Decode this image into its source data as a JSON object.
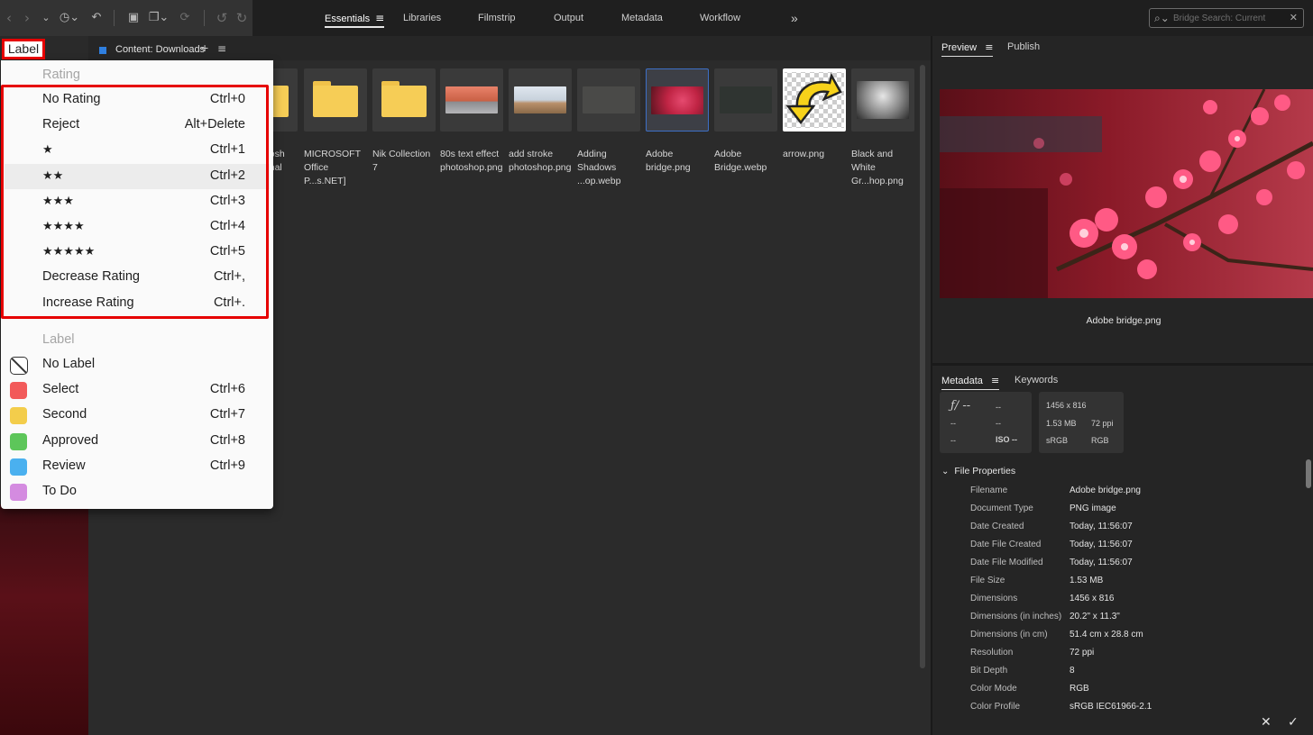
{
  "toolbar": {
    "workspaces": [
      {
        "label": "Essentials",
        "active": true
      },
      {
        "label": "Libraries"
      },
      {
        "label": "Filmstrip"
      },
      {
        "label": "Output"
      },
      {
        "label": "Metadata"
      },
      {
        "label": "Workflow"
      }
    ],
    "more_glyph": "»",
    "search_placeholder": "Bridge Search: Current"
  },
  "label_tab": "Label",
  "content": {
    "tab_title": "Content: Downloads",
    "items": [
      {
        "label": "otosh Final",
        "kind": "folder"
      },
      {
        "label": "MICROSOFT Office P...s.NET]",
        "kind": "folder"
      },
      {
        "label": "Nik Collection 7",
        "kind": "folder"
      },
      {
        "label": "80s text effect photoshop.png",
        "kind": "image"
      },
      {
        "label": "add stroke photoshop.png",
        "kind": "image"
      },
      {
        "label": "Adding Shadows ...op.webp",
        "kind": "image"
      },
      {
        "label": "Adobe bridge.png",
        "kind": "image",
        "selected": true
      },
      {
        "label": "Adobe Bridge.webp",
        "kind": "image"
      },
      {
        "label": "arrow.png",
        "kind": "image"
      },
      {
        "label": "Black and White Gr...hop.png",
        "kind": "image"
      }
    ]
  },
  "menu": {
    "rating_header": "Rating",
    "rating_items": [
      {
        "label": "No Rating",
        "shortcut": "Ctrl+0"
      },
      {
        "label": "Reject",
        "shortcut": "Alt+Delete"
      },
      {
        "label": "★",
        "shortcut": "Ctrl+1"
      },
      {
        "label": "★★",
        "shortcut": "Ctrl+2",
        "hover": true
      },
      {
        "label": "★★★",
        "shortcut": "Ctrl+3"
      },
      {
        "label": "★★★★",
        "shortcut": "Ctrl+4"
      },
      {
        "label": "★★★★★",
        "shortcut": "Ctrl+5"
      },
      {
        "label": "Decrease Rating",
        "shortcut": "Ctrl+,"
      },
      {
        "label": "Increase Rating",
        "shortcut": "Ctrl+."
      }
    ],
    "label_header": "Label",
    "label_items": [
      {
        "label": "No Label",
        "shortcut": "",
        "color": ""
      },
      {
        "label": "Select",
        "shortcut": "Ctrl+6",
        "color": "#f25a5a"
      },
      {
        "label": "Second",
        "shortcut": "Ctrl+7",
        "color": "#f3cd4b"
      },
      {
        "label": "Approved",
        "shortcut": "Ctrl+8",
        "color": "#5dc65a"
      },
      {
        "label": "Review",
        "shortcut": "Ctrl+9",
        "color": "#4ab0ef"
      },
      {
        "label": "To Do",
        "shortcut": "",
        "color": "#d48be0"
      }
    ]
  },
  "preview": {
    "tabs": [
      "Preview",
      "Publish"
    ],
    "caption": "Adobe bridge.png"
  },
  "metadata": {
    "tabs": [
      "Metadata",
      "Keywords"
    ],
    "box1": {
      "fstop": "ƒ/ --",
      "r1c2": "--",
      "r2c1": "--",
      "r2c2": "--",
      "r3c1": "--",
      "iso": "ISO --"
    },
    "box2": {
      "dims": "1456 x 816",
      "size": "1.53 MB",
      "ppi": "72 ppi",
      "profile": "sRGB",
      "mode": "RGB"
    },
    "file_properties_header": "File Properties",
    "properties": [
      {
        "k": "Filename",
        "v": "Adobe bridge.png"
      },
      {
        "k": "Document Type",
        "v": "PNG image"
      },
      {
        "k": "Date Created",
        "v": "Today, 11:56:07"
      },
      {
        "k": "Date File Created",
        "v": "Today, 11:56:07"
      },
      {
        "k": "Date File Modified",
        "v": "Today, 11:56:07"
      },
      {
        "k": "File Size",
        "v": "1.53 MB"
      },
      {
        "k": "Dimensions",
        "v": "1456 x 816"
      },
      {
        "k": "Dimensions (in inches)",
        "v": "20.2\" x 11.3\""
      },
      {
        "k": "Dimensions (in cm)",
        "v": "51.4 cm x 28.8 cm"
      },
      {
        "k": "Resolution",
        "v": "72 ppi"
      },
      {
        "k": "Bit Depth",
        "v": "8"
      },
      {
        "k": "Color Mode",
        "v": "RGB"
      },
      {
        "k": "Color Profile",
        "v": "sRGB IEC61966-2.1"
      }
    ]
  },
  "bottom": {
    "cancel_glyph": "✕",
    "ok_glyph": "✓"
  },
  "colors": {
    "highlight_box": "#e60000",
    "selection": "#3d6fc6",
    "accent_blue": "#2f7fe0"
  }
}
